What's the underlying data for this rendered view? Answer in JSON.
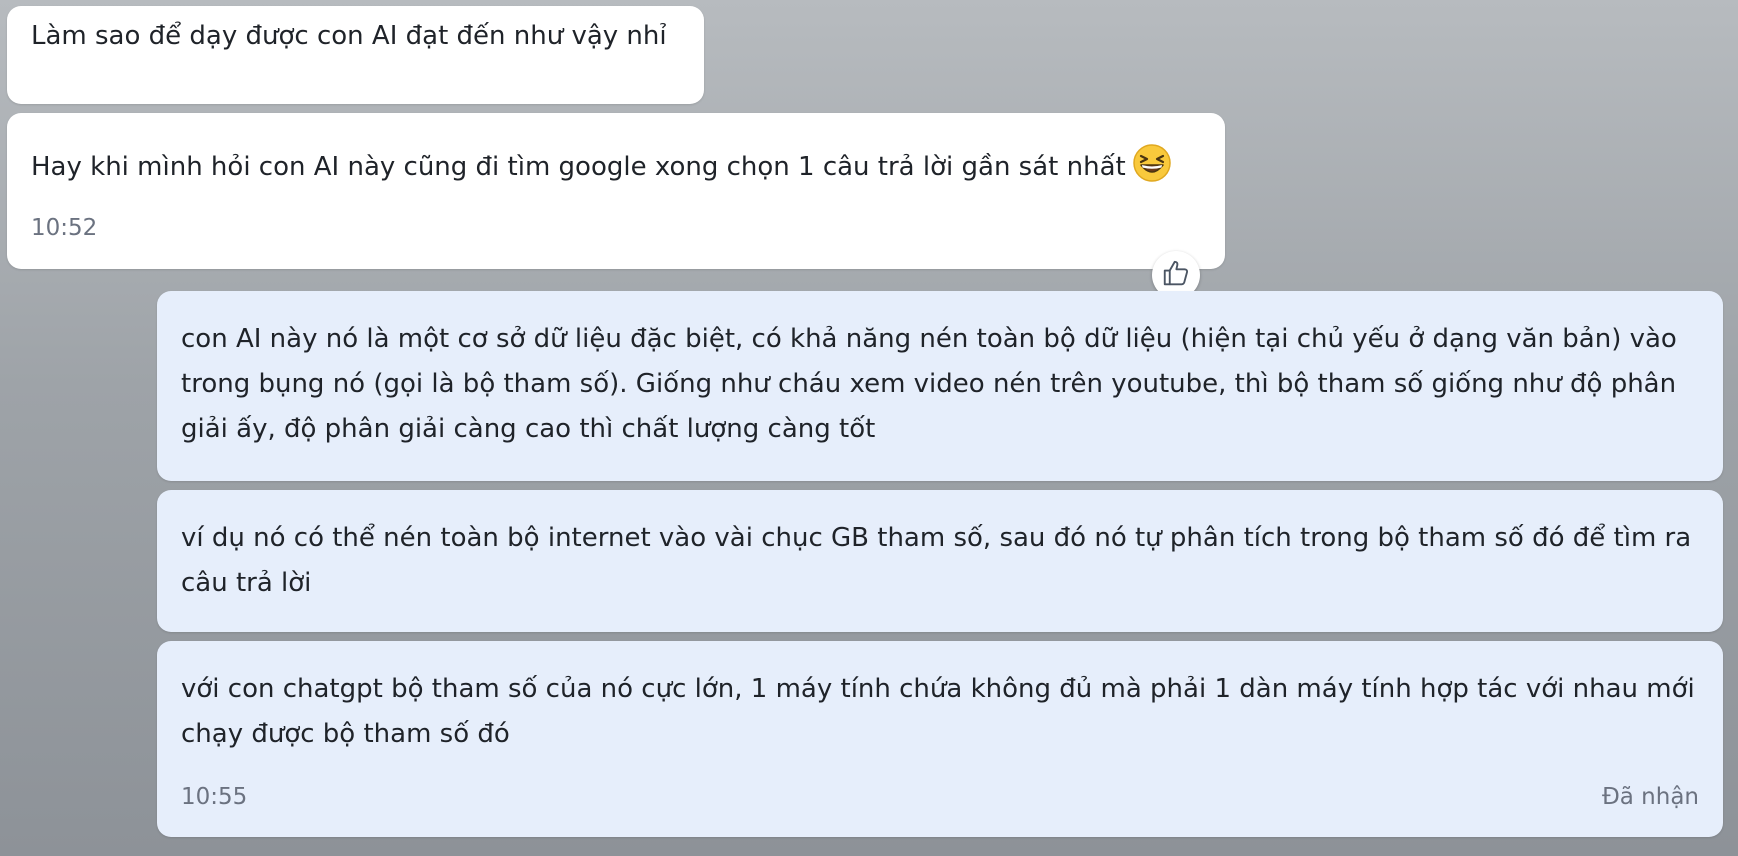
{
  "messages": {
    "incoming_1": {
      "text": "Làm sao để dạy được con AI đạt đến như vậy nhỉ"
    },
    "incoming_2": {
      "text": "Hay khi mình hỏi con AI này cũng đi tìm google xong chọn 1 câu trả lời gần sát nhất",
      "emoji": "laughing-face-emoji",
      "time": "10:52",
      "reaction_icon": "thumbs-up-icon"
    },
    "outgoing_1": {
      "text": "con AI này nó là một cơ sở dữ liệu đặc biệt, có khả năng nén toàn bộ dữ liệu (hiện tại chủ yếu ở dạng văn bản) vào trong bụng nó (gọi là bộ tham số). Giống như cháu xem video nén trên youtube, thì bộ tham số giống như độ phân giải ấy, độ phân giải càng cao thì chất lượng càng tốt"
    },
    "outgoing_2": {
      "text": "ví dụ nó có thể nén toàn bộ internet vào vài chục GB tham số, sau đó nó tự phân tích trong bộ tham số đó để tìm ra  câu trả lời"
    },
    "outgoing_3": {
      "text": "với con chatgpt bộ tham số của nó cực lớn, 1 máy tính chứa không đủ mà phải 1 dàn máy tính hợp tác với nhau mới chạy được bộ tham số đó",
      "time": "10:55",
      "status": "Đã nhận"
    }
  },
  "colors": {
    "incoming_bubble": "#ffffff",
    "outgoing_bubble": "#e6eefb",
    "text": "#1f2329",
    "meta_text": "#6b7280"
  }
}
